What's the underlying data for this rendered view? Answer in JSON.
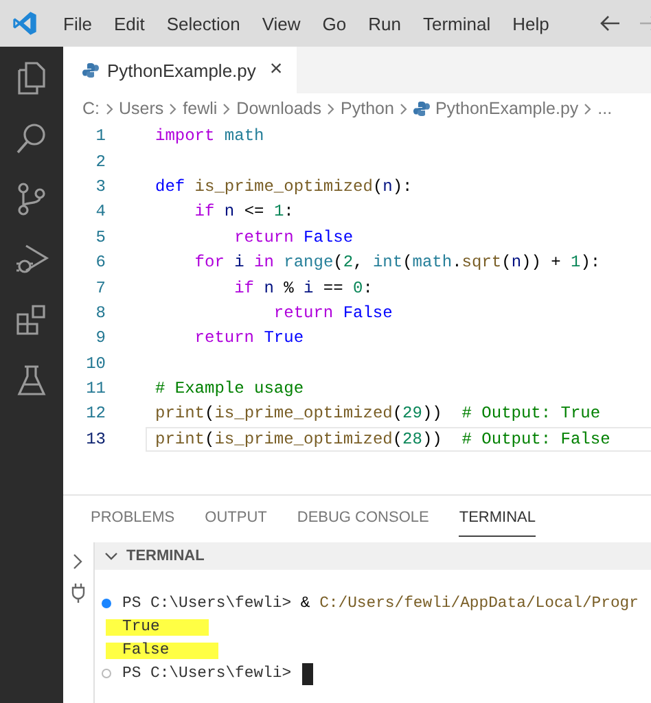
{
  "menu_bar": {
    "items": [
      "File",
      "Edit",
      "Selection",
      "View",
      "Go",
      "Run",
      "Terminal",
      "Help"
    ]
  },
  "editor_tabs": [
    {
      "label": "PythonExample.py",
      "selected": true,
      "close": "×"
    }
  ],
  "breadcrumb": {
    "items": [
      "C:",
      "Users",
      "fewli",
      "Downloads",
      "Python",
      "PythonExample.py",
      "..."
    ]
  },
  "code_lines": [
    {
      "number": "1",
      "current": false,
      "tokens": [
        {
          "text": "import",
          "kind": "keyword"
        },
        {
          "text": " math",
          "kind": "type"
        }
      ]
    },
    {
      "number": "2",
      "current": false
    },
    {
      "number": "3",
      "current": false,
      "tokens": [
        {
          "text": "def",
          "kind": "storage"
        },
        {
          "text": " is_prime_optimized",
          "kind": "function"
        },
        {
          "text": "(",
          "kind": "plain"
        },
        {
          "text": "n",
          "kind": "variable"
        },
        {
          "text": "):",
          "kind": "plain"
        }
      ]
    },
    {
      "number": "4",
      "current": false,
      "tokens": [
        {
          "text": "    if",
          "kind": "keyword"
        },
        {
          "text": " n",
          "kind": "variable"
        },
        {
          "text": " <= ",
          "kind": "plain"
        },
        {
          "text": "1",
          "kind": "number"
        },
        {
          "text": ":",
          "kind": "plain"
        }
      ]
    },
    {
      "number": "5",
      "current": false,
      "tokens": [
        {
          "text": "        return",
          "kind": "keyword"
        },
        {
          "text": " False",
          "kind": "constant"
        }
      ]
    },
    {
      "number": "6",
      "current": false,
      "tokens": [
        {
          "text": "    for",
          "kind": "keyword"
        },
        {
          "text": " i",
          "kind": "variable"
        },
        {
          "text": " in",
          "kind": "keyword"
        },
        {
          "text": " range",
          "kind": "type"
        },
        {
          "text": "(",
          "kind": "plain"
        },
        {
          "text": "2",
          "kind": "number"
        },
        {
          "text": ", ",
          "kind": "plain"
        },
        {
          "text": "int",
          "kind": "type"
        },
        {
          "text": "(",
          "kind": "plain"
        },
        {
          "text": "math",
          "kind": "type"
        },
        {
          "text": ".",
          "kind": "plain"
        },
        {
          "text": "sqrt",
          "kind": "function"
        },
        {
          "text": "(",
          "kind": "plain"
        },
        {
          "text": "n",
          "kind": "variable"
        },
        {
          "text": ")) + ",
          "kind": "plain"
        },
        {
          "text": "1",
          "kind": "number"
        },
        {
          "text": "):",
          "kind": "plain"
        }
      ]
    },
    {
      "number": "7",
      "current": false,
      "tokens": [
        {
          "text": "        if",
          "kind": "keyword"
        },
        {
          "text": " n",
          "kind": "variable"
        },
        {
          "text": " % ",
          "kind": "plain"
        },
        {
          "text": "i",
          "kind": "variable"
        },
        {
          "text": " == ",
          "kind": "plain"
        },
        {
          "text": "0",
          "kind": "number"
        },
        {
          "text": ":",
          "kind": "plain"
        }
      ]
    },
    {
      "number": "8",
      "current": false,
      "tokens": [
        {
          "text": "            return",
          "kind": "keyword"
        },
        {
          "text": " False",
          "kind": "constant"
        }
      ]
    },
    {
      "number": "9",
      "current": false,
      "tokens": [
        {
          "text": "    return",
          "kind": "keyword"
        },
        {
          "text": " True",
          "kind": "constant"
        }
      ]
    },
    {
      "number": "10",
      "current": false
    },
    {
      "number": "11",
      "current": false,
      "tokens": [
        {
          "text": "# Example usage",
          "kind": "comment"
        }
      ]
    },
    {
      "number": "12",
      "current": false,
      "tokens": [
        {
          "text": "print",
          "kind": "function"
        },
        {
          "text": "(",
          "kind": "plain"
        },
        {
          "text": "is_prime_optimized",
          "kind": "function"
        },
        {
          "text": "(",
          "kind": "plain"
        },
        {
          "text": "29",
          "kind": "number"
        },
        {
          "text": "))  ",
          "kind": "plain"
        },
        {
          "text": "# Output: True",
          "kind": "comment"
        }
      ]
    },
    {
      "number": "13",
      "current": true,
      "tokens": [
        {
          "text": "print",
          "kind": "function"
        },
        {
          "text": "(",
          "kind": "plain"
        },
        {
          "text": "is_prime_optimized",
          "kind": "function"
        },
        {
          "text": "(",
          "kind": "plain"
        },
        {
          "text": "28",
          "kind": "number"
        },
        {
          "text": "))  ",
          "kind": "plain"
        },
        {
          "text": "# Output: False",
          "kind": "comment"
        }
      ]
    }
  ],
  "panel_tabs": [
    {
      "label": "PROBLEMS",
      "selected": false
    },
    {
      "label": "OUTPUT",
      "selected": false
    },
    {
      "label": "DEBUG CONSOLE",
      "selected": false
    },
    {
      "label": "TERMINAL",
      "selected": true
    }
  ],
  "terminal": {
    "title": "TERMINAL",
    "expanded": true,
    "lines": [
      {
        "kind": "prompt",
        "succeeded": true,
        "prompt": "PS C:\\Users\\fewli>",
        "command": "&",
        "path": "C:/Users/fewli/AppData/Local/Progr",
        "cursor": false
      },
      {
        "kind": "output",
        "highlighted": true,
        "text": "True"
      },
      {
        "kind": "output",
        "highlighted": true,
        "text": "False"
      },
      {
        "kind": "prompt",
        "succeeded": false,
        "prompt": "PS C:\\Users\\fewli>",
        "cursor": true
      }
    ]
  }
}
